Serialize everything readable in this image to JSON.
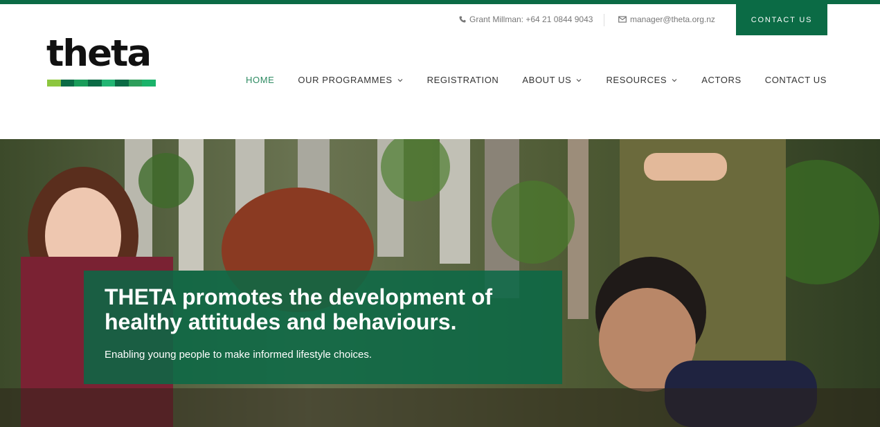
{
  "topbar": {
    "phone_text": "Grant Millman: +64 21 0844 9043",
    "phone_icon": "phone-icon",
    "email_text": "manager@theta.org.nz",
    "email_icon": "envelope-icon",
    "contact_button": "CONTACT US"
  },
  "logo": {
    "text": "theta",
    "stripe_colors": [
      "#8dc63f",
      "#0b6b45",
      "#1a9c5a",
      "#0b6b45",
      "#22b573",
      "#0b6b45",
      "#2e9e5b",
      "#1bb36a"
    ]
  },
  "nav": {
    "items": [
      {
        "label": "HOME",
        "active": true,
        "has_dropdown": false
      },
      {
        "label": "OUR PROGRAMMES",
        "active": false,
        "has_dropdown": true
      },
      {
        "label": "REGISTRATION",
        "active": false,
        "has_dropdown": false
      },
      {
        "label": "ABOUT US",
        "active": false,
        "has_dropdown": true
      },
      {
        "label": "RESOURCES",
        "active": false,
        "has_dropdown": true
      },
      {
        "label": "ACTORS",
        "active": false,
        "has_dropdown": false
      },
      {
        "label": "CONTACT US",
        "active": false,
        "has_dropdown": false
      }
    ]
  },
  "hero": {
    "headline": "THETA promotes the development of healthy attitudes and behaviours.",
    "subline": "Enabling young people to make informed lifestyle choices."
  },
  "colors": {
    "brand_green": "#0b6b45",
    "active_nav": "#2e8b62"
  }
}
